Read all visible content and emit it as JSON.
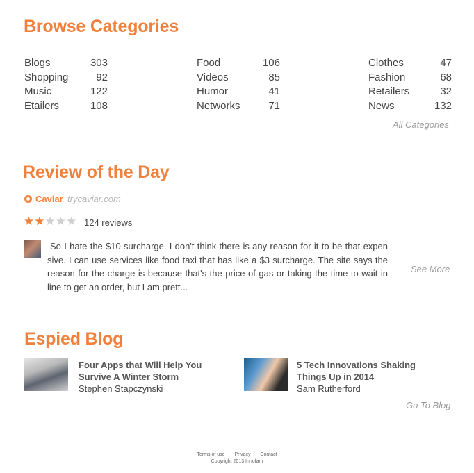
{
  "browse": {
    "title": "Browse Categories",
    "columns": [
      [
        {
          "name": "Blogs",
          "count": "303"
        },
        {
          "name": "Shopping",
          "count": "92"
        },
        {
          "name": "Music",
          "count": "122"
        },
        {
          "name": "Etailers",
          "count": "108"
        }
      ],
      [
        {
          "name": "Food",
          "count": "106"
        },
        {
          "name": "Videos",
          "count": "85"
        },
        {
          "name": "Humor",
          "count": "41"
        },
        {
          "name": "Networks",
          "count": "71"
        }
      ],
      [
        {
          "name": "Clothes",
          "count": "47"
        },
        {
          "name": "Fashion",
          "count": "68"
        },
        {
          "name": "Retailers",
          "count": "32"
        },
        {
          "name": "News",
          "count": "132"
        }
      ]
    ],
    "all_link": "All Categories"
  },
  "review": {
    "title": "Review of the Day",
    "business_name": "Caviar",
    "business_url": "trycaviar.com",
    "rating": 2,
    "max_rating": 5,
    "review_count": "124 reviews",
    "text": "So I hate the $10 surcharge. I don't think there is any reason for it to be that expen sive. I can use services like food taxi that has like a $3 surcharge. The site says the reason for the charge is because that's the price of gas or taking the time to wait in line to get an order, but I am prett...",
    "see_more": "See More"
  },
  "blog": {
    "title": "Espied Blog",
    "posts": [
      {
        "title": "Four Apps that Will Help You Survive A Winter Storm",
        "author": "Stephen Stapczynski"
      },
      {
        "title": "5 Tech Innovations Shaking Things Up in 2014",
        "author": "Sam Rutherford"
      }
    ],
    "go_link": "Go To Blog"
  },
  "footer": {
    "links": [
      "Terms of use",
      "Privacy",
      "Contact"
    ],
    "copyright": "Copyright 2013 Innofam"
  },
  "colors": {
    "accent": "#f0813c",
    "text": "#444444",
    "muted": "#9a9a9a"
  }
}
